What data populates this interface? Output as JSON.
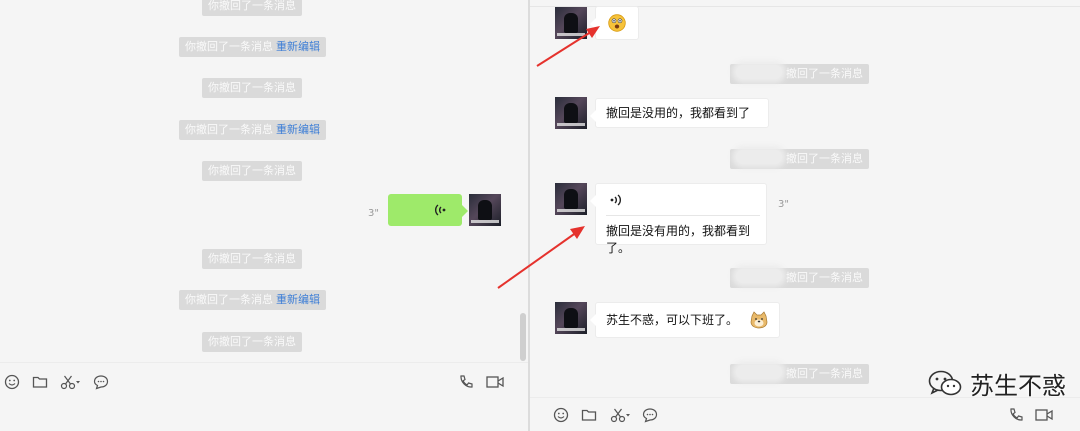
{
  "left": {
    "system_messages": [
      {
        "text": "你撤回了一条消息",
        "edit": ""
      },
      {
        "text": "你撤回了一条消息",
        "edit": "重新编辑"
      },
      {
        "text": "你撤回了一条消息",
        "edit": ""
      },
      {
        "text": "你撤回了一条消息",
        "edit": "重新编辑"
      },
      {
        "text": "你撤回了一条消息",
        "edit": ""
      },
      {
        "text": "你撤回了一条消息",
        "edit": ""
      },
      {
        "text": "你撤回了一条消息",
        "edit": "重新编辑"
      },
      {
        "text": "你撤回了一条消息",
        "edit": ""
      }
    ],
    "voice_duration": "3\""
  },
  "right": {
    "recall_notice": "撤回了一条消息",
    "messages": {
      "msg1": "撤回是没用的，我都看到了",
      "voice_duration": "3\"",
      "transcription": "撤回是没有用的，我都看到了。",
      "msg3": "苏生不惑，可以下班了。"
    }
  },
  "watermark": {
    "text": "苏生不惑"
  },
  "icons": [
    "emoji-icon",
    "folder-icon",
    "scissors-icon",
    "chat-bubble-icon",
    "phone-icon",
    "video-icon",
    "wechat-logo-icon"
  ],
  "colors": {
    "pane_bg": "#f5f5f5",
    "system_tag": "#dadada",
    "edit_link": "#3f7fd6",
    "self_bubble": "#9eea6a",
    "arrow": "#e5322d"
  }
}
